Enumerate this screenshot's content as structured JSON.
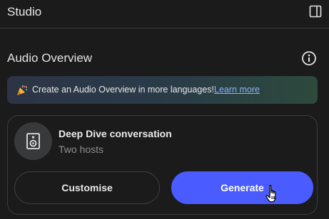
{
  "header": {
    "title": "Studio",
    "toggle_icon": "side-panel-icon"
  },
  "section": {
    "title": "Audio Overview",
    "info_icon": "info-icon"
  },
  "banner": {
    "icon": "party-popper-icon",
    "text": "Create an Audio Overview in more languages!",
    "link": "Learn more"
  },
  "card": {
    "icon": "speaker-icon",
    "title": "Deep Dive conversation",
    "subtitle": "Two hosts",
    "customise_label": "Customise",
    "generate_label": "Generate"
  },
  "colors": {
    "background": "#1b1b1c",
    "accent": "#4a5cff",
    "link": "#8ab4f8"
  }
}
